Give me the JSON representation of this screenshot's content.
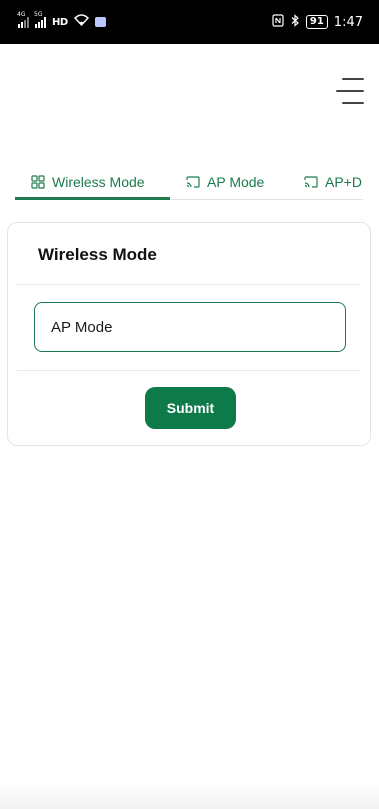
{
  "status_bar": {
    "signal_1_label": "4G",
    "signal_2_label": "5G",
    "hd_label": "HD",
    "battery": "91",
    "time": "1:47",
    "icons": [
      "signal-icon",
      "signal-icon",
      "hd-icon",
      "wifi-icon",
      "bag-icon",
      "nfc-icon",
      "bluetooth-icon",
      "battery-icon"
    ]
  },
  "header": {
    "menu_icon": "hamburger-menu-icon"
  },
  "tabs": [
    {
      "label": "Wireless Mode",
      "icon": "grid-icon",
      "active": true
    },
    {
      "label": "AP Mode",
      "icon": "cast-icon",
      "active": false
    },
    {
      "label": "AP+D",
      "icon": "cast-icon",
      "active": false
    }
  ],
  "card": {
    "title": "Wireless Mode",
    "select_value": "AP Mode",
    "submit_label": "Submit"
  },
  "colors": {
    "accent": "#1c7a4c",
    "button": "#0e7a4a",
    "status_bar_bg": "#000000"
  }
}
